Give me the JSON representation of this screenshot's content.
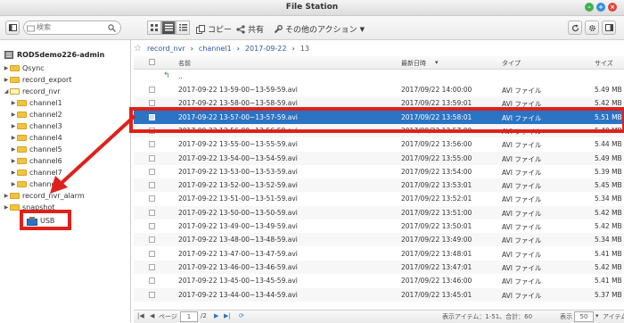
{
  "window": {
    "title": "File Station"
  },
  "toolbar": {
    "search_placeholder": "検索",
    "copy": "コピー",
    "share": "共有",
    "more": "その他のアクション"
  },
  "tree": {
    "root": "RODSdemo226-admin",
    "items": [
      {
        "label": "Qsync"
      },
      {
        "label": "record_export"
      },
      {
        "label": "record_nvr"
      },
      {
        "label": "channel1"
      },
      {
        "label": "channel2"
      },
      {
        "label": "channel3"
      },
      {
        "label": "channel4"
      },
      {
        "label": "channel5"
      },
      {
        "label": "channel6"
      },
      {
        "label": "channel7"
      },
      {
        "label": "channel8"
      },
      {
        "label": "record_nvr_alarm"
      },
      {
        "label": "snapshot"
      },
      {
        "label": "USB"
      }
    ]
  },
  "breadcrumb": [
    "record_nvr",
    "channel1",
    "2017-09-22",
    "13"
  ],
  "columns": {
    "name": "名前",
    "modified": "最新日時",
    "type": "タイプ",
    "size": "サイズ"
  },
  "parent_row": "..",
  "files": [
    {
      "name": "2017-09-22 13-59-00~13-59-59.avi",
      "modified": "2017/09/22 14:00:00",
      "type": "AVI ファイル",
      "size": "5.49 MB"
    },
    {
      "name": "2017-09-22 13-58-00~13-58-59.avi",
      "modified": "2017/09/22 13:59:01",
      "type": "AVI ファイル",
      "size": "5.42 MB"
    },
    {
      "name": "2017-09-22 13-57-00~13-57-59.avi",
      "modified": "2017/09/22 13:58:01",
      "type": "AVI ファイル",
      "size": "5.51 MB"
    },
    {
      "name": "2017-09-22 13-56-00~13-56-59.avi",
      "modified": "2017/09/22 13:57:00",
      "type": "AVI ファイル",
      "size": "5.40 MB"
    },
    {
      "name": "2017-09-22 13-55-00~13-55-59.avi",
      "modified": "2017/09/22 13:56:00",
      "type": "AVI ファイル",
      "size": "5.44 MB"
    },
    {
      "name": "2017-09-22 13-54-00~13-54-59.avi",
      "modified": "2017/09/22 13:55:00",
      "type": "AVI ファイル",
      "size": "5.49 MB"
    },
    {
      "name": "2017-09-22 13-53-00~13-53-59.avi",
      "modified": "2017/09/22 13:54:00",
      "type": "AVI ファイル",
      "size": "5.39 MB"
    },
    {
      "name": "2017-09-22 13-52-00~13-52-59.avi",
      "modified": "2017/09/22 13:53:01",
      "type": "AVI ファイル",
      "size": "5.45 MB"
    },
    {
      "name": "2017-09-22 13-51-00~13-51-59.avi",
      "modified": "2017/09/22 13:52:01",
      "type": "AVI ファイル",
      "size": "5.34 MB"
    },
    {
      "name": "2017-09-22 13-50-00~13-50-59.avi",
      "modified": "2017/09/22 13:51:00",
      "type": "AVI ファイル",
      "size": "5.42 MB"
    },
    {
      "name": "2017-09-22 13-49-00~13-49-59.avi",
      "modified": "2017/09/22 13:50:01",
      "type": "AVI ファイル",
      "size": "5.42 MB"
    },
    {
      "name": "2017-09-22 13-48-00~13-48-59.avi",
      "modified": "2017/09/22 13:49:00",
      "type": "AVI ファイル",
      "size": "5.34 MB"
    },
    {
      "name": "2017-09-22 13-47-00~13-47-59.avi",
      "modified": "2017/09/22 13:48:01",
      "type": "AVI ファイル",
      "size": "5.41 MB"
    },
    {
      "name": "2017-09-22 13-46-00~13-46-59.avi",
      "modified": "2017/09/22 13:47:01",
      "type": "AVI ファイル",
      "size": "5.42 MB"
    },
    {
      "name": "2017-09-22 13-45-00~13-45-59.avi",
      "modified": "2017/09/22 13:46:00",
      "type": "AVI ファイル",
      "size": "5.41 MB"
    },
    {
      "name": "2017-09-22 13-44-00~13-44-59.avi",
      "modified": "2017/09/22 13:45:01",
      "type": "AVI ファイル",
      "size": "5.37 MB"
    }
  ],
  "selected_index": 2,
  "status": {
    "page_label": "ページ",
    "page_value": "1",
    "page_total": "/2",
    "summary": "表示アイテム：1-51、合計：60",
    "display_label": "表示",
    "per_page": "50",
    "items_label": "アイテム"
  },
  "colors": {
    "accent": "#2b74c4",
    "annotation": "#e0201a",
    "folder": "#f2c340"
  }
}
